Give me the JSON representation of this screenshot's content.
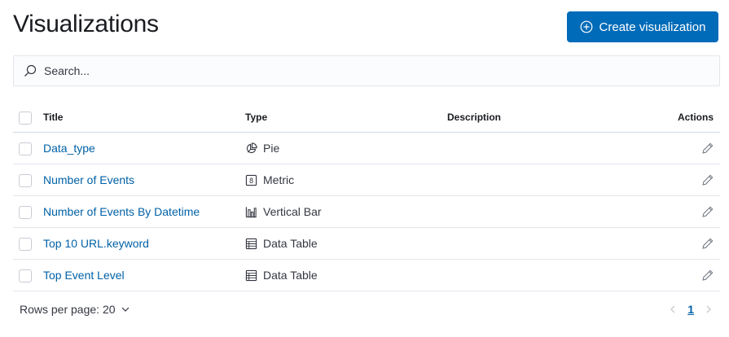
{
  "page": {
    "title": "Visualizations"
  },
  "create_button": {
    "label": "Create visualization",
    "icon": "plus-circle-icon"
  },
  "search": {
    "placeholder": "Search...",
    "value": "",
    "icon": "search-icon"
  },
  "table": {
    "columns": [
      "Title",
      "Type",
      "Description",
      "Actions"
    ],
    "rows": [
      {
        "title": "Data_type",
        "type": "Pie",
        "type_icon": "pie-icon",
        "description": ""
      },
      {
        "title": "Number of Events",
        "type": "Metric",
        "type_icon": "metric-icon",
        "description": ""
      },
      {
        "title": "Number of Events By Datetime",
        "type": "Vertical Bar",
        "type_icon": "vertical-bar-icon",
        "description": ""
      },
      {
        "title": "Top 10 URL.keyword",
        "type": "Data Table",
        "type_icon": "data-table-icon",
        "description": ""
      },
      {
        "title": "Top Event Level",
        "type": "Data Table",
        "type_icon": "data-table-icon",
        "description": ""
      }
    ],
    "action_icon": "pencil-icon"
  },
  "footer": {
    "rows_per_page_label": "Rows per page: 20",
    "current_page": "1"
  },
  "colors": {
    "primary": "#006bb8",
    "link": "#0061a6",
    "border": "#e3e6ec"
  }
}
